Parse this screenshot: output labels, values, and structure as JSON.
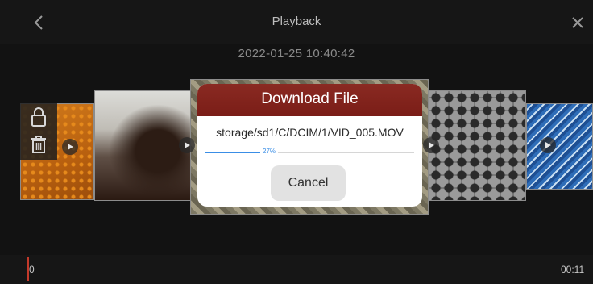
{
  "header": {
    "title": "Playback",
    "back_icon": "chevron-left-icon",
    "close_icon": "close-icon"
  },
  "datetime": "2022-01-25 10:40:42",
  "side_actions": [
    "lock-icon",
    "trash-icon"
  ],
  "dialog": {
    "title": "Download File",
    "file_path": "storage/sd1/C/DCIM/1/VID_005.MOV",
    "progress": 27,
    "progress_label": "27%",
    "cancel_label": "Cancel"
  },
  "timeline": {
    "start": "0",
    "end": "00:11"
  },
  "colors": {
    "dialog_header": "#7a1d17",
    "progress": "#3a8ee6",
    "playhead": "#c43a2b"
  }
}
